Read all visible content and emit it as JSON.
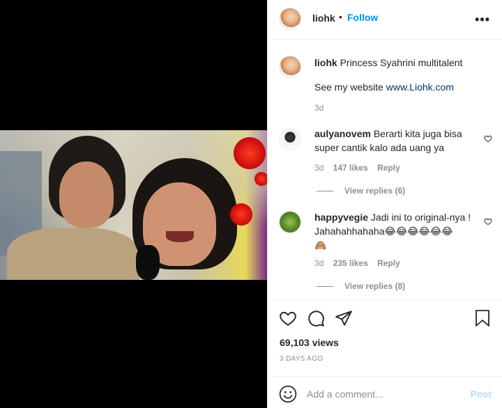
{
  "header": {
    "username": "liohk",
    "separator": "•",
    "follow_label": "Follow",
    "more_label": "•••"
  },
  "caption": {
    "username": "liohk",
    "text": "Princess Syahrini multitalent",
    "line2_prefix": "See my website ",
    "link_text": "www.Liohk.com",
    "age": "3d"
  },
  "comments": [
    {
      "username": "aulyanovem",
      "text_line1": "Berarti kita juga bisa",
      "text_line2": "super cantik kalo ada uang ya",
      "age": "3d",
      "likes": "147 likes",
      "reply_label": "Reply",
      "view_replies": "View replies (6)"
    },
    {
      "username": "happyvegie",
      "text_line1": "Jadi ini to original-nya !",
      "text_line2": "Jahahahhahaha😂😂😂😂😂😂",
      "text_line3": "🙈",
      "age": "3d",
      "likes": "235 likes",
      "reply_label": "Reply",
      "view_replies": "View replies (8)"
    }
  ],
  "stats": {
    "views": "69,103 views",
    "date": "3 DAYS AGO"
  },
  "comment_box": {
    "placeholder": "Add a comment...",
    "post_label": "Post"
  },
  "icons": {
    "like": "heart-icon",
    "comment": "comment-icon",
    "share": "paper-plane-icon",
    "save": "bookmark-icon",
    "emoji": "emoji-icon",
    "more": "more-icon"
  }
}
